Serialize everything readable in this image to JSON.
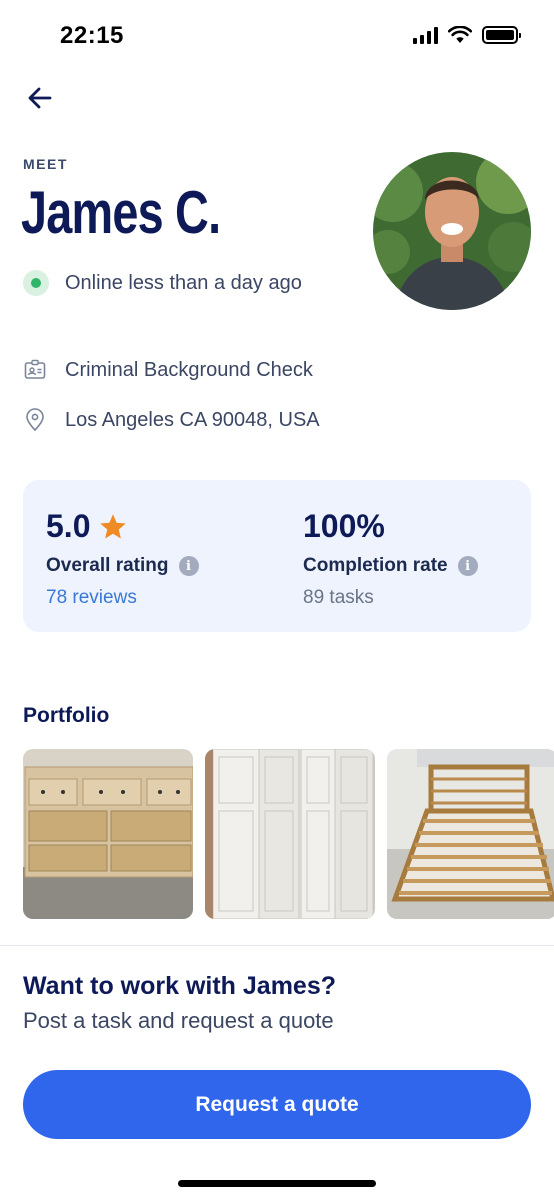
{
  "status_bar": {
    "time": "22:15"
  },
  "header": {
    "back_icon": "arrow-left-icon"
  },
  "profile": {
    "eyebrow": "MEET",
    "name": "James C.",
    "online_status": "Online less than a day ago"
  },
  "details": [
    {
      "icon": "id-badge-icon",
      "label": "Criminal Background Check"
    },
    {
      "icon": "location-pin-icon",
      "label": "Los Angeles CA 90048, USA"
    }
  ],
  "stats": {
    "rating": {
      "value": "5.0",
      "label": "Overall rating",
      "sub": "78 reviews"
    },
    "completion": {
      "value": "100%",
      "label": "Completion rate",
      "sub": "89 tasks"
    }
  },
  "portfolio": {
    "title": "Portfolio"
  },
  "cta": {
    "title": "Want to work with James?",
    "subtitle": "Post a task and request a quote",
    "button": "Request a quote"
  },
  "colors": {
    "primary": "#2f66ec",
    "navy": "#0e1a57",
    "online_green": "#2fb56a",
    "star": "#f08a24",
    "link": "#3a78d6",
    "card_bg": "#eef3fd"
  }
}
